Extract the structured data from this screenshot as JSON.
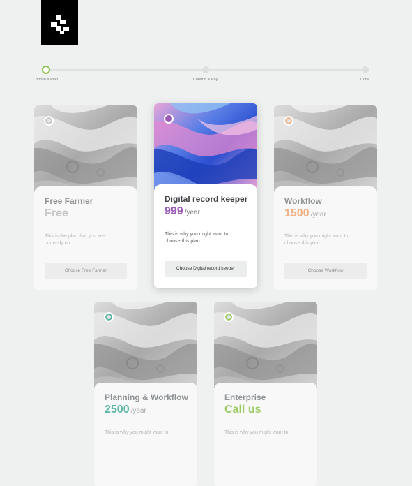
{
  "logo": {
    "icon": "blocks-logo-icon"
  },
  "stepper": {
    "steps": [
      "Choose a Plan",
      "Confirm & Pay",
      "Done"
    ],
    "active_index": 0,
    "active_color": "#8bc34a"
  },
  "plans": [
    {
      "name": "Free Farmer",
      "price": "Free",
      "unit": "",
      "description": "This is the plan that you are currently on",
      "button": "Choose Free Farmer",
      "color": "#c6c8ca",
      "image": "marble-grayscale",
      "selected": false
    },
    {
      "name": "Digital record keeper",
      "price": "999",
      "unit": "/year",
      "description": "This is why you might want to choose this plan",
      "button": "Choose Digital record keeper",
      "color": "#9b59b6",
      "image": "marble-colorful",
      "selected": true
    },
    {
      "name": "Workflow",
      "price": "1500",
      "unit": "/year",
      "description": "This is why you might want to choose this plan",
      "button": "Choose Workflow",
      "color": "#f3b182",
      "image": "marble-grayscale",
      "selected": false
    },
    {
      "name": "Planning & Workflow",
      "price": "2500",
      "unit": "/year",
      "description": "This is why you might want to",
      "button": "",
      "color": "#5bb5a5",
      "image": "marble-grayscale",
      "selected": false
    },
    {
      "name": "Enterprise",
      "price": "Call us",
      "unit": "",
      "description": "This is why you might want to",
      "button": "",
      "color": "#9ccc65",
      "image": "marble-grayscale",
      "selected": false
    }
  ]
}
